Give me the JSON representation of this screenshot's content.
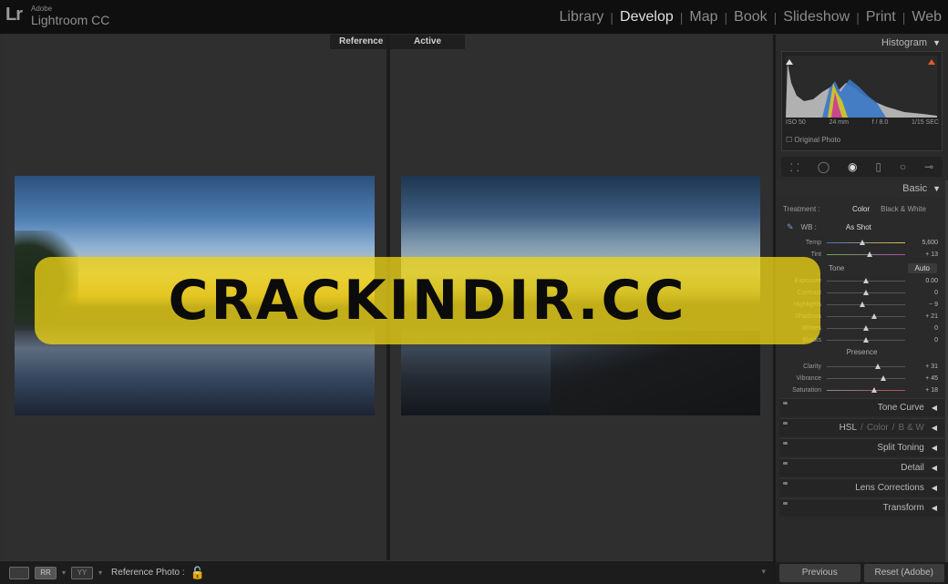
{
  "app": {
    "logo": "Lr",
    "vendor": "Adobe",
    "name": "Lightroom CC"
  },
  "modules": [
    {
      "label": "Library",
      "active": false
    },
    {
      "label": "Develop",
      "active": true
    },
    {
      "label": "Map",
      "active": false
    },
    {
      "label": "Book",
      "active": false
    },
    {
      "label": "Slideshow",
      "active": false
    },
    {
      "label": "Print",
      "active": false
    },
    {
      "label": "Web",
      "active": false
    }
  ],
  "module_separator": "|",
  "compare": {
    "reference_label": "Reference",
    "active_label": "Active"
  },
  "watermark": "CRACKINDIR.CC",
  "toolbar": {
    "btn_rr": "RR",
    "btn_yy": "YY",
    "reference_photo_label": "Reference Photo :"
  },
  "histogram": {
    "title": "Histogram",
    "iso": "ISO 50",
    "focal": "24 mm",
    "aperture": "f / 8.0",
    "shutter": "1/15 SEC",
    "original_photo": "Original Photo"
  },
  "basic": {
    "title": "Basic",
    "treatment_label": "Treatment :",
    "treatment_color": "Color",
    "treatment_bw": "Black & White",
    "wb_label": "WB :",
    "wb_value": "As Shot",
    "temp": {
      "name": "Temp",
      "value": "5,600",
      "pos": 0.45
    },
    "tint": {
      "name": "Tint",
      "value": "+ 13",
      "pos": 0.55
    },
    "tone_label": "Tone",
    "auto_label": "Auto",
    "tone": [
      {
        "name": "Exposure",
        "value": "0.00",
        "pos": 0.5
      },
      {
        "name": "Contrast",
        "value": "0",
        "pos": 0.5
      },
      {
        "name": "Highlights",
        "value": "− 9",
        "pos": 0.45
      },
      {
        "name": "Shadows",
        "value": "+ 21",
        "pos": 0.6
      },
      {
        "name": "Whites",
        "value": "0",
        "pos": 0.5
      },
      {
        "name": "Blacks",
        "value": "0",
        "pos": 0.5
      }
    ],
    "presence_label": "Presence",
    "presence": [
      {
        "name": "Clarity",
        "value": "+ 31",
        "pos": 0.65
      },
      {
        "name": "Vibrance",
        "value": "+ 45",
        "pos": 0.72
      },
      {
        "name": "Saturation",
        "value": "+ 18",
        "pos": 0.6
      }
    ]
  },
  "collapsed_panels": {
    "tone_curve": "Tone Curve",
    "hsl_a": "HSL",
    "hsl_sep": "/",
    "hsl_b": "Color",
    "hsl_c": "B & W",
    "split_toning": "Split Toning",
    "detail": "Detail",
    "lens_corrections": "Lens Corrections",
    "transform": "Transform"
  },
  "buttons": {
    "previous": "Previous",
    "reset": "Reset (Adobe)"
  },
  "colors": {
    "watermark_bg": "#ECD214",
    "accent_lock": "#D8B232"
  }
}
